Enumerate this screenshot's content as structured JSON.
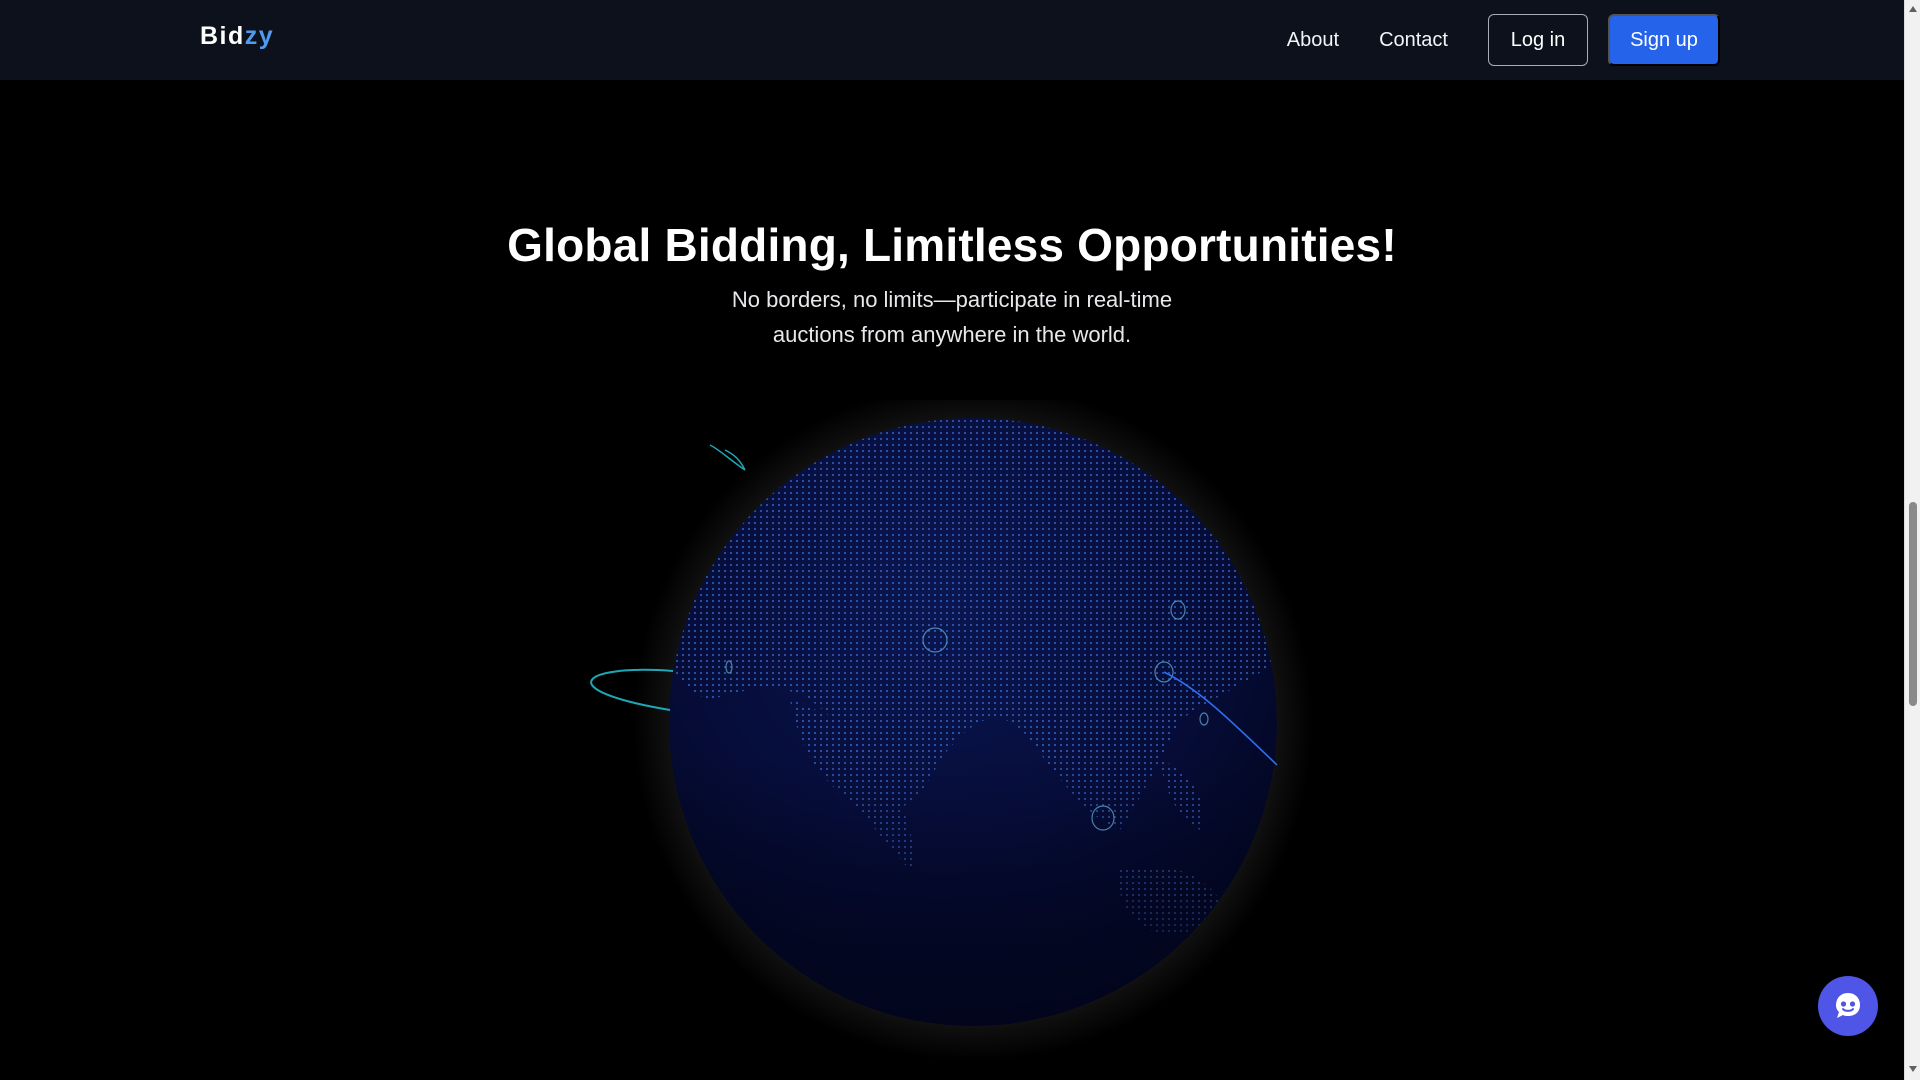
{
  "brand": {
    "logo_part1": "Bid",
    "logo_part2": "zy",
    "accent": "#4f9bf0"
  },
  "nav": {
    "links": [
      {
        "label": "About"
      },
      {
        "label": "Contact"
      }
    ],
    "login_label": "Log in",
    "signup_label": "Sign up",
    "signup_color": "#2563eb"
  },
  "hero": {
    "title": "Global Bidding, Limitless Opportunities!",
    "subtitle_line1": "No borders, no limits—participate in real-time",
    "subtitle_line2": "auctions from anywhere in the world."
  },
  "globe": {
    "icon": "dotted-globe-illustration",
    "base_color": "#040a2e",
    "dot_color": "#3a6cd4"
  },
  "chat": {
    "icon": "chat-bot-icon",
    "color": "#4f55e6"
  }
}
